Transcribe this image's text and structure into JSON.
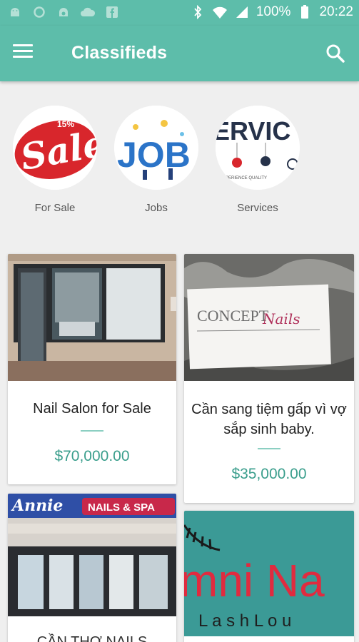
{
  "status_bar": {
    "battery": "100%",
    "time": "20:22",
    "left_icons": [
      "android-icon",
      "sync-icon",
      "android-icon",
      "cloud-icon",
      "facebook-icon"
    ],
    "right_icons": [
      "bluetooth-icon",
      "wifi-icon",
      "signal-icon",
      "battery-icon"
    ]
  },
  "app_bar": {
    "title": "Classifieds",
    "menu_icon": "menu-icon",
    "search_icon": "search-icon"
  },
  "categories": [
    {
      "label": "For Sale",
      "image_text": "Sale",
      "image_badge": "15%"
    },
    {
      "label": "Jobs",
      "image_text": "JOB"
    },
    {
      "label": "Services",
      "image_text": "ERVIC",
      "image_subtext": "EXPERIENCE  QUALITY"
    }
  ],
  "listings": [
    {
      "title": "Nail Salon for Sale",
      "price": "$70,000.00"
    },
    {
      "title": "Cần sang tiệm gấp vì vợ sắp sinh baby.",
      "price": "$35,000.00",
      "sign_text": "CONCEPT",
      "sign_script": "Nails"
    },
    {
      "title": "CẦN THỢ NAILS",
      "sign_script": "Annie",
      "sign_text": "NAILS & SPA"
    },
    {
      "title": "",
      "sign_text": "mni Na",
      "sign_sub": "L a s h   L o u"
    }
  ],
  "colors": {
    "primary": "#5dbdaa",
    "price": "#3a9e8c",
    "background": "#efefef"
  }
}
